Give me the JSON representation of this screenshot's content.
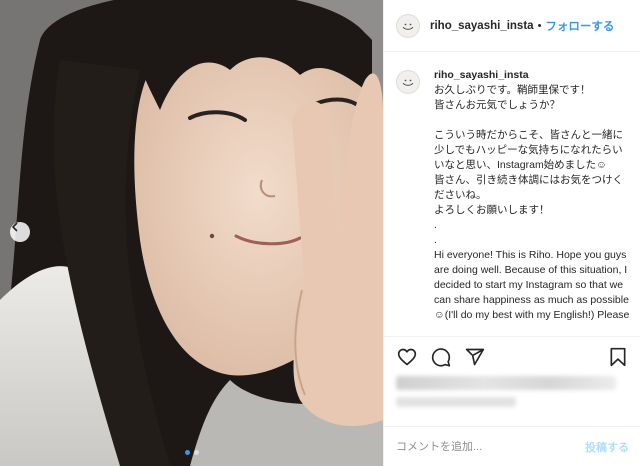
{
  "header": {
    "username": "riho_sayashi_insta",
    "separator": "•",
    "follow_label": "フォローする"
  },
  "caption": {
    "username": "riho_sayashi_insta",
    "text": "お久しぶりです。鞘師里保です！\n皆さんお元気でしょうか？\n\nこういう時だからこそ、皆さんと一緒に少しでもハッピーな気持ちになれたらいいなと思い、Instagram始めました☺︎\n皆さん、引き続き体調にはお気をつけくださいね。\nよろしくお願いします！\n.\n.\nHi everyone! This is Riho. Hope you guys are doing well. Because of this situation, I decided to start my Instagram so that we can share happiness as much as possible☺︎(I'll do my best with my English!) Please"
  },
  "actions": {
    "like_icon": "heart-icon",
    "comment_icon": "comment-icon",
    "share_icon": "share-icon",
    "save_icon": "bookmark-icon"
  },
  "comment_box": {
    "placeholder": "コメントを追加...",
    "post_label": "投稿する"
  },
  "carousel": {
    "total": 2,
    "active_index": 1
  },
  "colors": {
    "link_blue": "#3897f0",
    "disabled_blue": "#b2dffc",
    "border": "#efefef"
  }
}
